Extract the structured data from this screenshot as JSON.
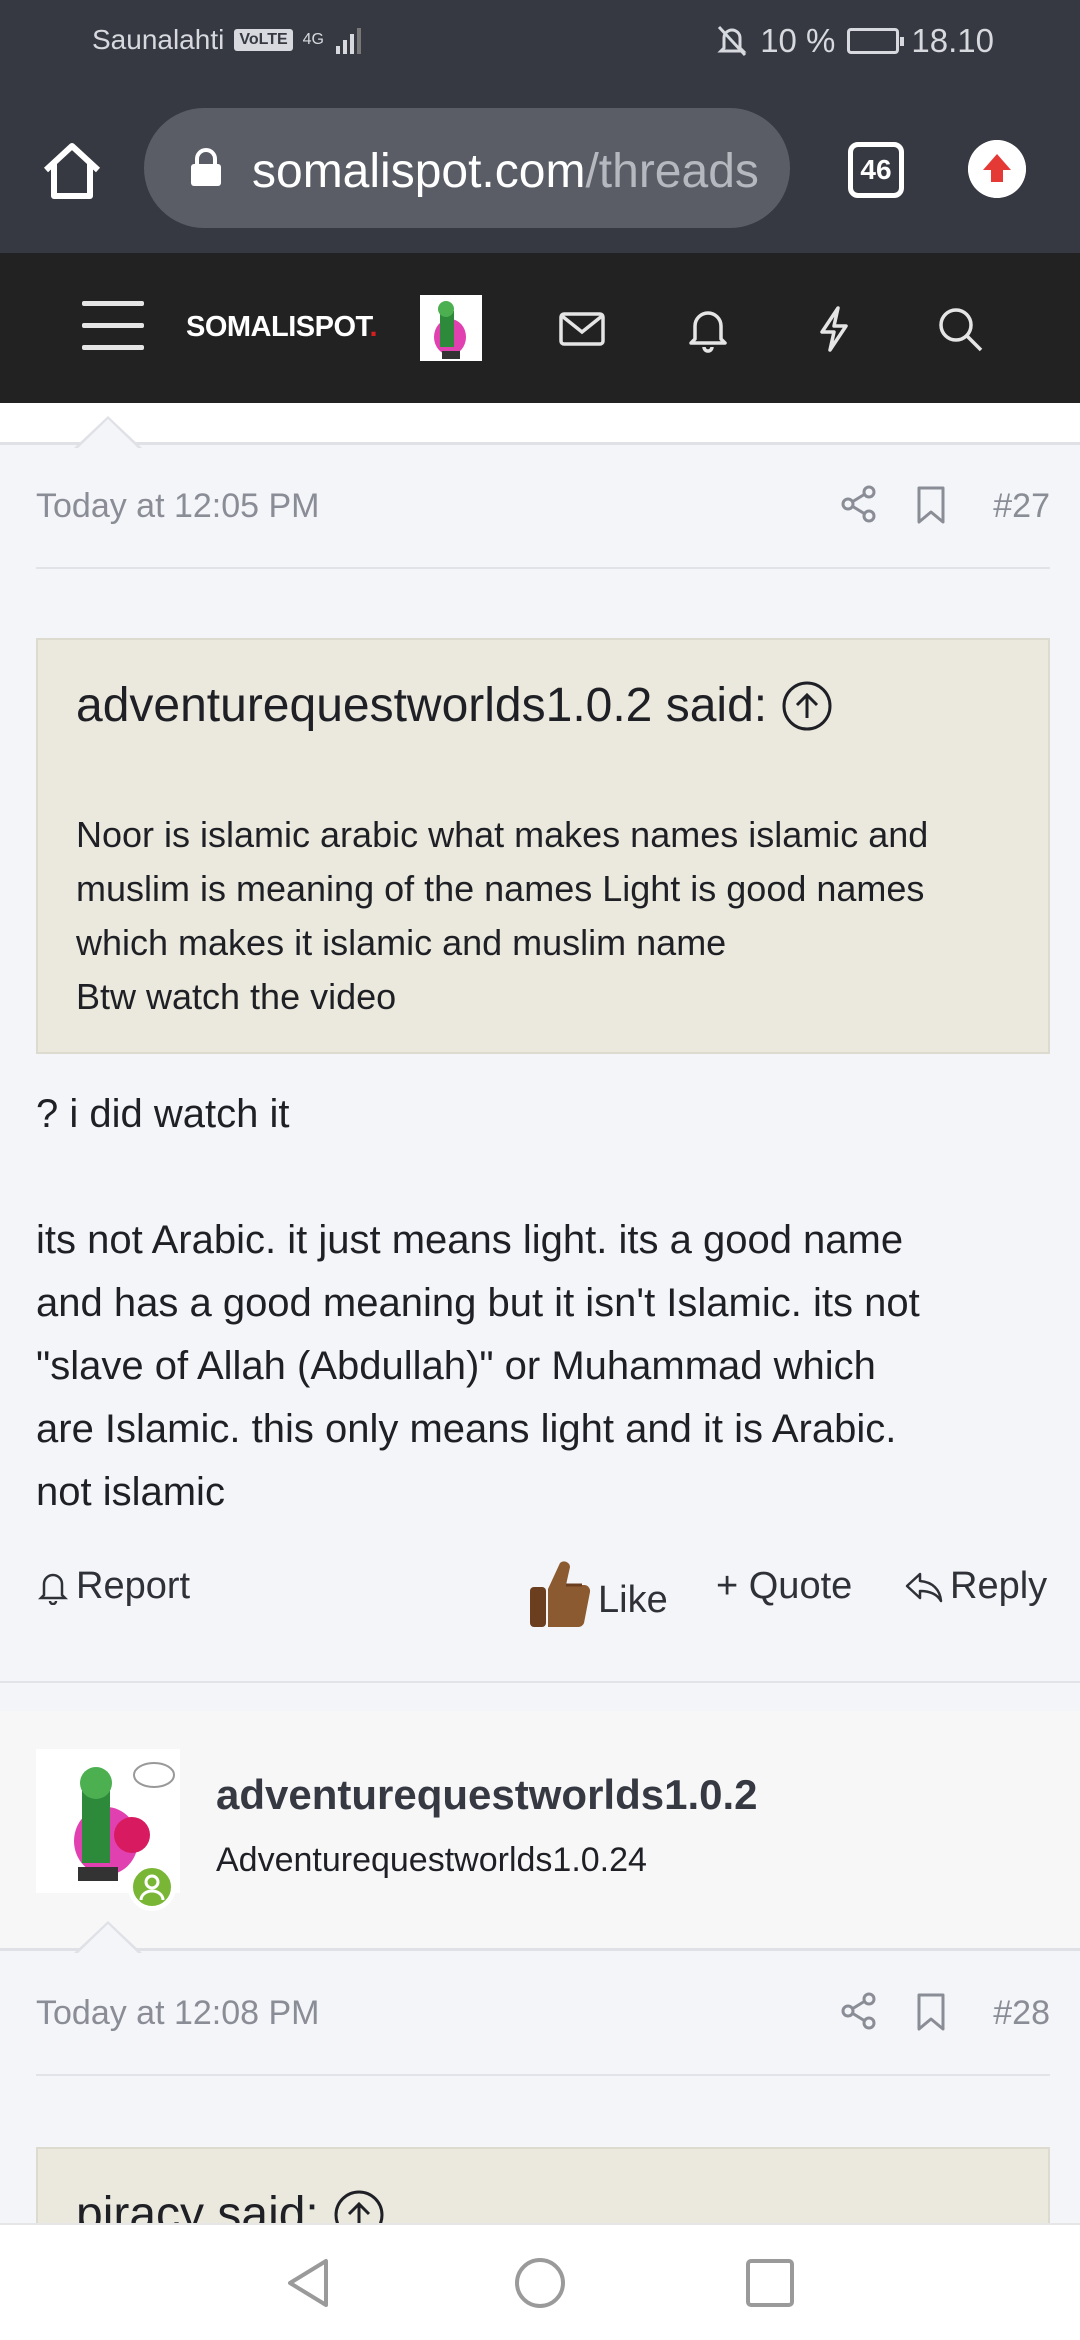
{
  "status_bar": {
    "carrier": "Saunalahti",
    "volte": "VoLTE",
    "network": "4G",
    "battery_percent": "10 %",
    "time": "18.10"
  },
  "browser": {
    "url_main": "somalispot.com",
    "url_path": "/threads",
    "tab_count": "46"
  },
  "site": {
    "logo_text": "SOMALISPOT",
    "logo_dot": "."
  },
  "posts": [
    {
      "date": "Today at 12:05 PM",
      "number": "#27",
      "quote": {
        "author_line": "adventurequestworlds1.0.2 said:",
        "lines": [
          "Noor is islamic arabic what makes names islamic and",
          "muslim is meaning of the names Light is good names",
          "which makes it islamic and muslim name",
          "Btw watch the video"
        ]
      },
      "body_lines": [
        "? i did watch it",
        "",
        "its not Arabic. it just means light. its a good name",
        "and has a good meaning but it isn't Islamic. its not",
        "\"slave of Allah (Abdullah)\" or Muhammad which",
        "are Islamic. this only means light and it is Arabic.",
        "not islamic"
      ],
      "actions": {
        "report": "Report",
        "like": "Like",
        "quote": "+ Quote",
        "reply": "Reply"
      }
    },
    {
      "user_name": "adventurequestworlds1.0.2",
      "user_title": "Adventurequestworlds1.0.24",
      "date": "Today at 12:08 PM",
      "number": "#28",
      "quote_author_line": "piracy said:"
    }
  ],
  "colors": {
    "chrome_bg": "#363942",
    "nav_bg": "#222222",
    "quote_bg": "#ebe9dd",
    "online": "#7ab636",
    "update_arrow": "#e53935"
  }
}
